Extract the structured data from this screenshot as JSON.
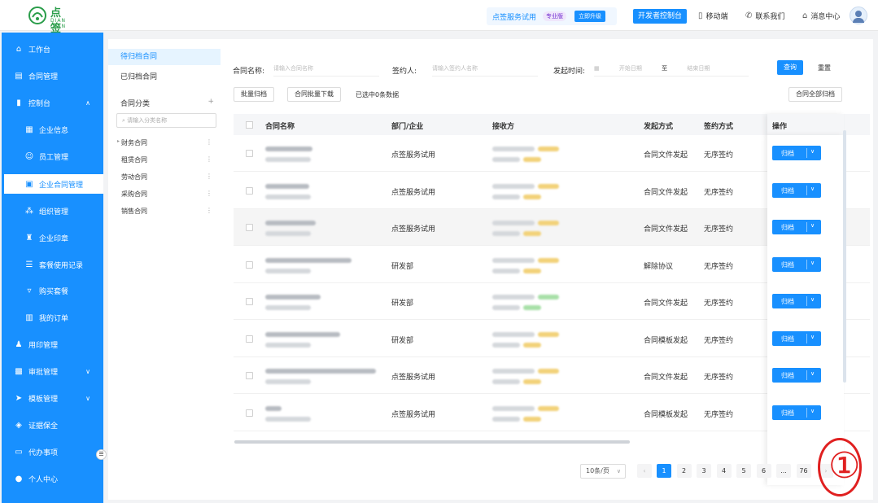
{
  "header": {
    "logo_text": "点 签",
    "logo_sub": "DIAN QIAN",
    "promo_text": "点签服务试用",
    "promo_tag": "专业版",
    "promo_button": "立即升级",
    "open_button": "开发者控制台",
    "links": [
      {
        "label": "移动端",
        "icon": "mobile-icon"
      },
      {
        "label": "联系我们",
        "icon": "phone-icon"
      },
      {
        "label": "消息中心",
        "icon": "bell-icon"
      }
    ]
  },
  "sidebar": {
    "items": [
      {
        "label": "工作台",
        "icon": "home-icon"
      },
      {
        "label": "合同管理",
        "icon": "contract-icon"
      },
      {
        "label": "控制台",
        "icon": "chart-icon",
        "expanded": true
      },
      {
        "label": "企业信息",
        "icon": "building-icon",
        "sub": true
      },
      {
        "label": "员工管理",
        "icon": "user-icon",
        "sub": true
      },
      {
        "label": "企业合同管理",
        "icon": "document-icon",
        "sub": true,
        "active": true
      },
      {
        "label": "组织管理",
        "icon": "org-icon",
        "sub": true
      },
      {
        "label": "企业印章",
        "icon": "stamp-icon",
        "sub": true
      },
      {
        "label": "套餐使用记录",
        "icon": "list-icon",
        "sub": true
      },
      {
        "label": "购买套餐",
        "icon": "cart-icon",
        "sub": true
      },
      {
        "label": "我的订单",
        "icon": "order-icon",
        "sub": true
      },
      {
        "label": "用印管理",
        "icon": "seal-icon"
      },
      {
        "label": "审批管理",
        "icon": "approval-icon",
        "chevron": true
      },
      {
        "label": "模板管理",
        "icon": "template-icon",
        "chevron": true
      },
      {
        "label": "证据保全",
        "icon": "shield-icon"
      },
      {
        "label": "代办事项",
        "icon": "todo-icon"
      },
      {
        "label": "个人中心",
        "icon": "person-icon"
      }
    ]
  },
  "category_panel": {
    "tabs": [
      "待归档合同",
      "已归档合同"
    ],
    "heading": "合同分类",
    "search_placeholder": "请输入分类名称",
    "nodes": [
      "财务合同",
      "租赁合同",
      "劳动合同",
      "采购合同",
      "销售合同"
    ]
  },
  "filters": {
    "contract_name_label": "合同名称:",
    "contract_name_placeholder": "请输入合同名称",
    "signer_label": "签约人:",
    "signer_placeholder": "请输入签约人名称",
    "time_label": "发起时间:",
    "start_placeholder": "开始日期",
    "range_sep": "至",
    "end_placeholder": "结束日期",
    "query_button": "查询",
    "reset_button": "重置"
  },
  "toolbar": {
    "batch_archive": "批量归档",
    "batch_download": "合同批量下载",
    "selected_text": "已选中0条数据",
    "archive_all": "合同全部归档"
  },
  "table": {
    "columns": [
      "合同名称",
      "部门/企业",
      "接收方",
      "发起方式",
      "签约方式",
      "操作"
    ],
    "rows": [
      {
        "dept": "点签服务试用",
        "method": "合同文件发起",
        "sign": "无序签约",
        "tag": "gold"
      },
      {
        "dept": "点签服务试用",
        "method": "合同文件发起",
        "sign": "无序签约",
        "tag": "gold"
      },
      {
        "dept": "点签服务试用",
        "method": "合同文件发起",
        "sign": "无序签约",
        "tag": "gold"
      },
      {
        "dept": "研发部",
        "method": "解除协议",
        "sign": "无序签约",
        "tag": "gold"
      },
      {
        "dept": "研发部",
        "method": "合同文件发起",
        "sign": "无序签约",
        "tag": "green"
      },
      {
        "dept": "研发部",
        "method": "合同模板发起",
        "sign": "无序签约",
        "tag": "gold"
      },
      {
        "dept": "点签服务试用",
        "method": "合同文件发起",
        "sign": "无序签约",
        "tag": "gold"
      },
      {
        "dept": "点签服务试用",
        "method": "合同模板发起",
        "sign": "无序签约",
        "tag": "gold"
      }
    ],
    "action_label": "归档"
  },
  "pagination": {
    "page_size": "10条/页",
    "pages": [
      "1",
      "2",
      "3",
      "4",
      "5",
      "6",
      "...",
      "76"
    ],
    "current": "1"
  },
  "annotation": {
    "number": "①"
  }
}
